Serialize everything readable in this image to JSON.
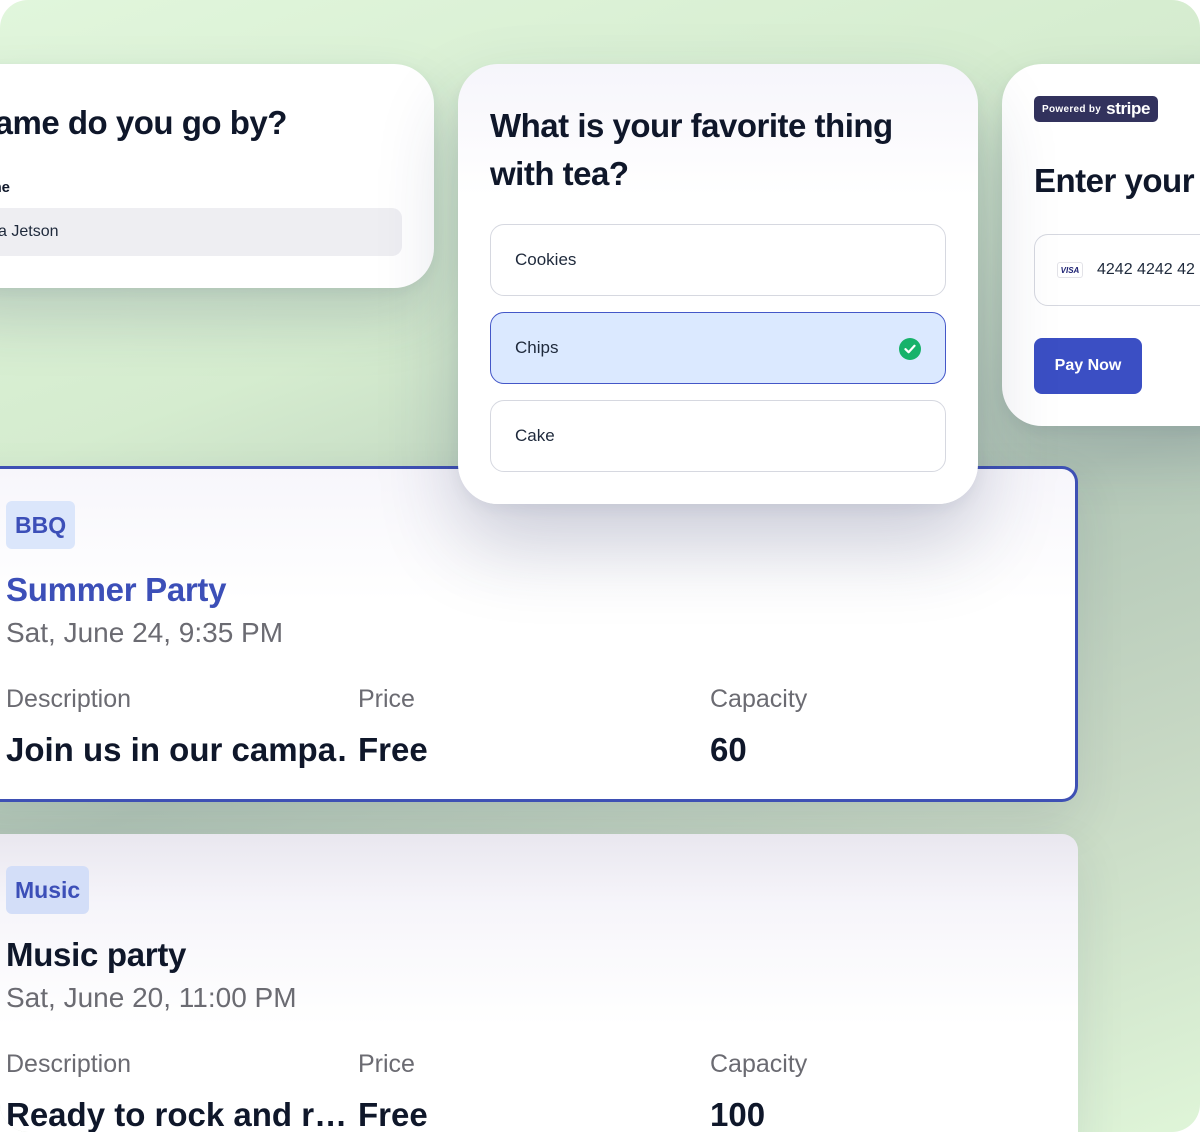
{
  "name_card": {
    "question": "at name do you go by?",
    "label": "ame",
    "value": "a Jetson"
  },
  "tea_card": {
    "question": "What is your favorite thing with tea?",
    "options": [
      {
        "label": "Cookies",
        "selected": false
      },
      {
        "label": "Chips",
        "selected": true
      },
      {
        "label": "Cake",
        "selected": false
      }
    ]
  },
  "payment_card": {
    "powered_by": "Powered by",
    "brand": "stripe",
    "title": "Enter your",
    "card_brand": "VISA",
    "card_number": "4242 4242 42",
    "pay_button": "Pay Now"
  },
  "events": [
    {
      "tag": "BBQ",
      "title": "Summer Party",
      "datetime": "Sat, June 24, 9:35 PM",
      "description_label": "Description",
      "description": "Join us in our  campa…",
      "price_label": "Price",
      "price": "Free",
      "capacity_label": "Capacity",
      "capacity": "60"
    },
    {
      "tag": "Music",
      "title": "Music party",
      "datetime": "Sat, June 20, 11:00 PM",
      "description_label": "Description",
      "description": "Ready to rock and r…",
      "price_label": "Price",
      "price": "Free",
      "capacity_label": "Capacity",
      "capacity": "100"
    }
  ],
  "colors": {
    "accent": "#3e50b4",
    "selected_bg": "#dbe9ff",
    "check_green": "#17b26a",
    "stripe_badge": "#32325d",
    "background_green": "#d5eccf"
  }
}
